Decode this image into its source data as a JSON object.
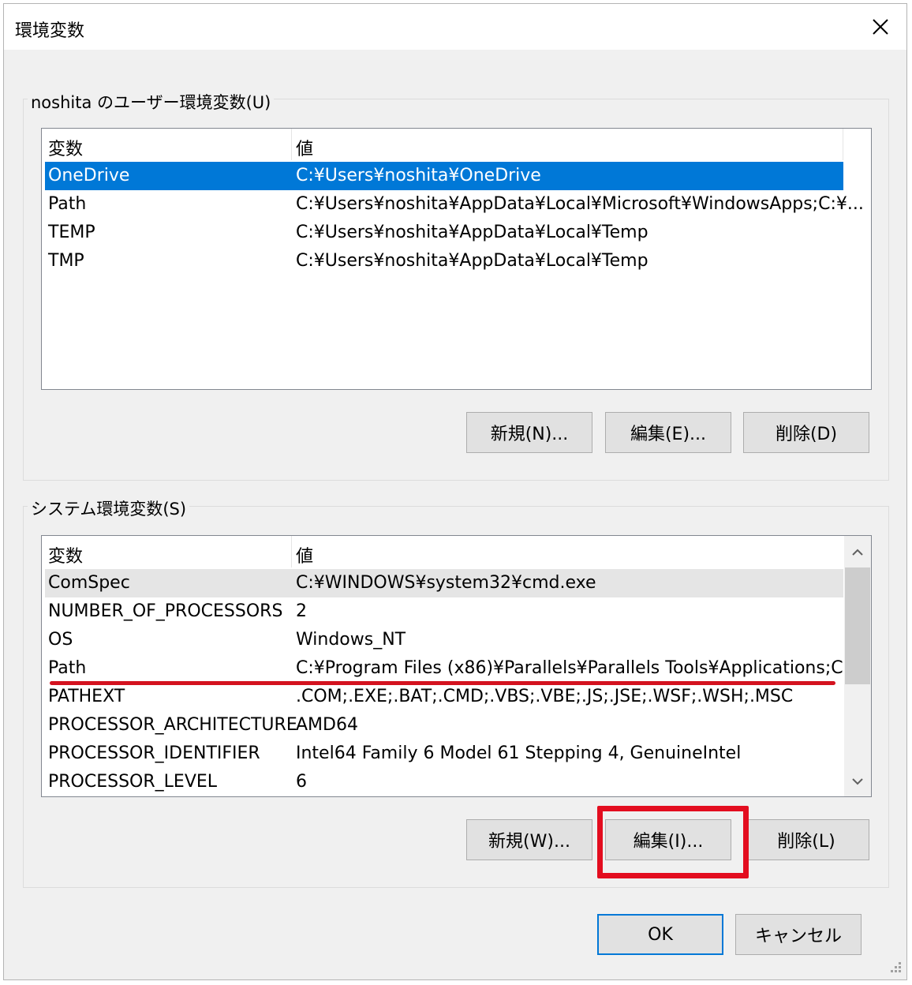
{
  "window": {
    "title": "環境変数",
    "close_icon": "close-icon"
  },
  "user_section": {
    "label": "noshita のユーザー環境変数(U)",
    "columns": [
      "変数",
      "値"
    ],
    "rows": [
      {
        "name": "OneDrive",
        "value": "C:¥Users¥noshita¥OneDrive",
        "selected": true
      },
      {
        "name": "Path",
        "value": "C:¥Users¥noshita¥AppData¥Local¥Microsoft¥WindowsApps;C:¥..."
      },
      {
        "name": "TEMP",
        "value": "C:¥Users¥noshita¥AppData¥Local¥Temp"
      },
      {
        "name": "TMP",
        "value": "C:¥Users¥noshita¥AppData¥Local¥Temp"
      }
    ],
    "buttons": {
      "new": "新規(N)...",
      "edit": "編集(E)...",
      "delete": "削除(D)"
    }
  },
  "system_section": {
    "label": "システム環境変数(S)",
    "columns": [
      "変数",
      "値"
    ],
    "rows": [
      {
        "name": "ComSpec",
        "value": "C:¥WINDOWS¥system32¥cmd.exe"
      },
      {
        "name": "NUMBER_OF_PROCESSORS",
        "value": "2"
      },
      {
        "name": "OS",
        "value": "Windows_NT"
      },
      {
        "name": "Path",
        "value": "C:¥Program Files (x86)¥Parallels¥Parallels Tools¥Applications;C:..."
      },
      {
        "name": "PATHEXT",
        "value": ".COM;.EXE;.BAT;.CMD;.VBS;.VBE;.JS;.JSE;.WSF;.WSH;.MSC"
      },
      {
        "name": "PROCESSOR_ARCHITECTURE",
        "value": "AMD64"
      },
      {
        "name": "PROCESSOR_IDENTIFIER",
        "value": "Intel64 Family 6 Model 61 Stepping 4, GenuineIntel"
      },
      {
        "name": "PROCESSOR_LEVEL",
        "value": "6"
      }
    ],
    "buttons": {
      "new": "新規(W)...",
      "edit": "編集(I)...",
      "delete": "削除(L)"
    }
  },
  "footer": {
    "ok": "OK",
    "cancel": "キャンセル"
  },
  "colors": {
    "selection": "#0078d7",
    "annotation_red": "#e30d1f",
    "dialog_bg": "#f0f0f0"
  }
}
